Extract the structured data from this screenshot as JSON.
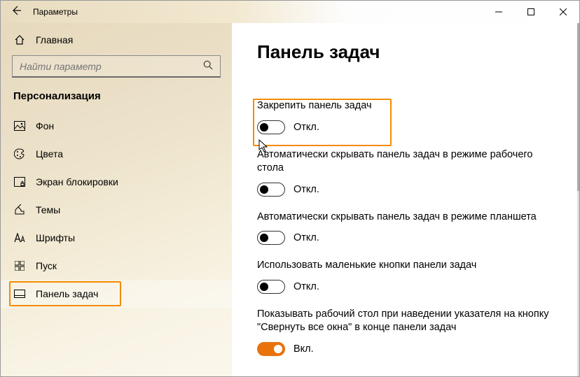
{
  "window": {
    "title": "Параметры"
  },
  "sidebar": {
    "home": "Главная",
    "search_placeholder": "Найти параметр",
    "category": "Персонализация",
    "items": [
      {
        "label": "Фон"
      },
      {
        "label": "Цвета"
      },
      {
        "label": "Экран блокировки"
      },
      {
        "label": "Темы"
      },
      {
        "label": "Шрифты"
      },
      {
        "label": "Пуск"
      },
      {
        "label": "Панель задач"
      }
    ]
  },
  "page": {
    "title": "Панель задач",
    "settings": [
      {
        "label": "Закрепить панель задач",
        "state": "Откл."
      },
      {
        "label": "Автоматически скрывать панель задач в режиме рабочего стола",
        "state": "Откл."
      },
      {
        "label": "Автоматически скрывать панель задач в режиме планшета",
        "state": "Откл."
      },
      {
        "label": "Использовать маленькие кнопки панели задач",
        "state": "Откл."
      },
      {
        "label": "Показывать рабочий стол при наведении указателя на кнопку \"Свернуть все окна\" в конце панели задач",
        "state": "Вкл."
      }
    ]
  },
  "colors": {
    "accent": "#e8720c",
    "highlight": "#f28c00"
  }
}
